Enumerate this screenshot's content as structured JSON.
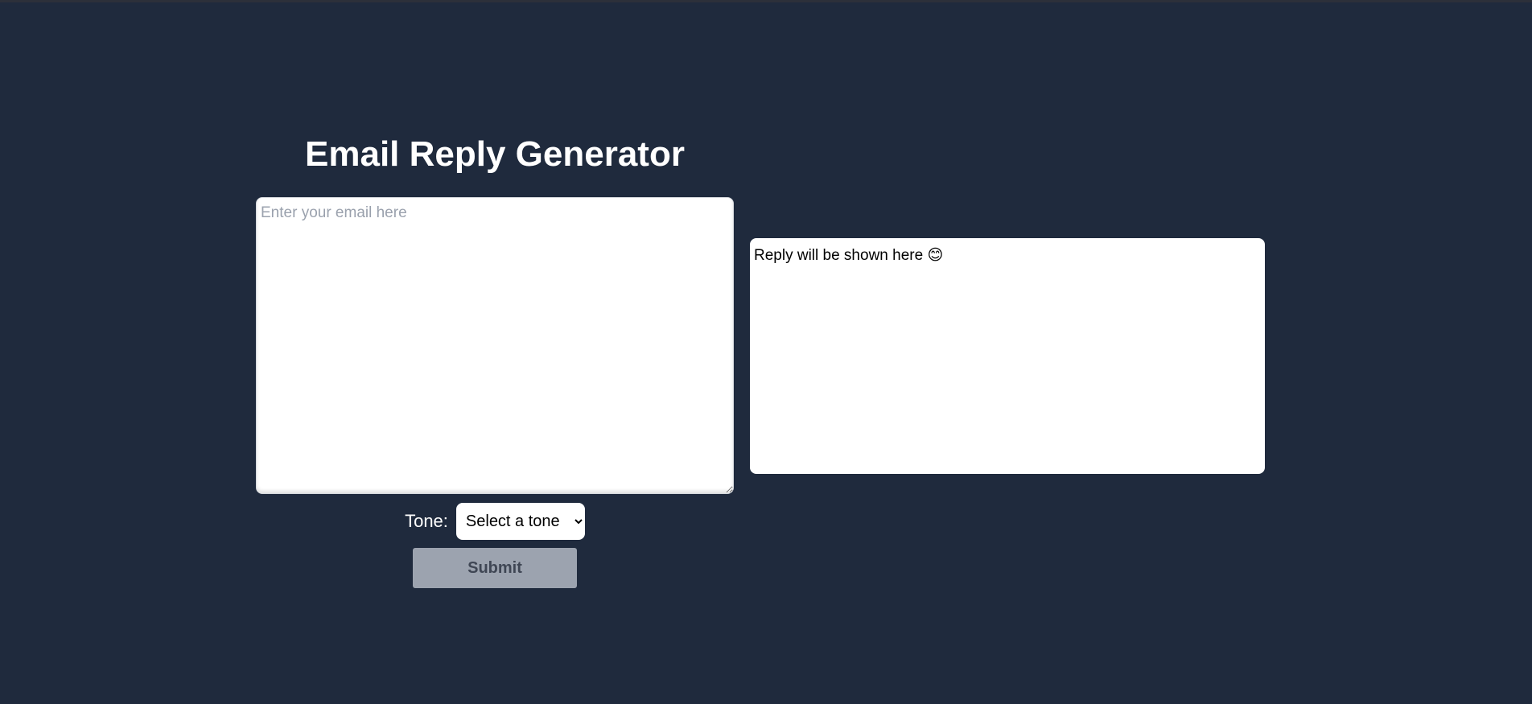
{
  "page": {
    "title": "Email Reply Generator"
  },
  "email_input": {
    "placeholder": "Enter your email here",
    "value": ""
  },
  "reply": {
    "text": "Reply will be shown here 😊"
  },
  "tone": {
    "label": "Tone:",
    "selected": "Select a tone",
    "options": [
      "Select a tone"
    ]
  },
  "submit": {
    "label": "Submit",
    "disabled": true
  },
  "colors": {
    "background": "#1f2a3d",
    "button_disabled_bg": "#9ca3af",
    "button_disabled_text": "#3f4654",
    "panel_bg": "#ffffff"
  }
}
